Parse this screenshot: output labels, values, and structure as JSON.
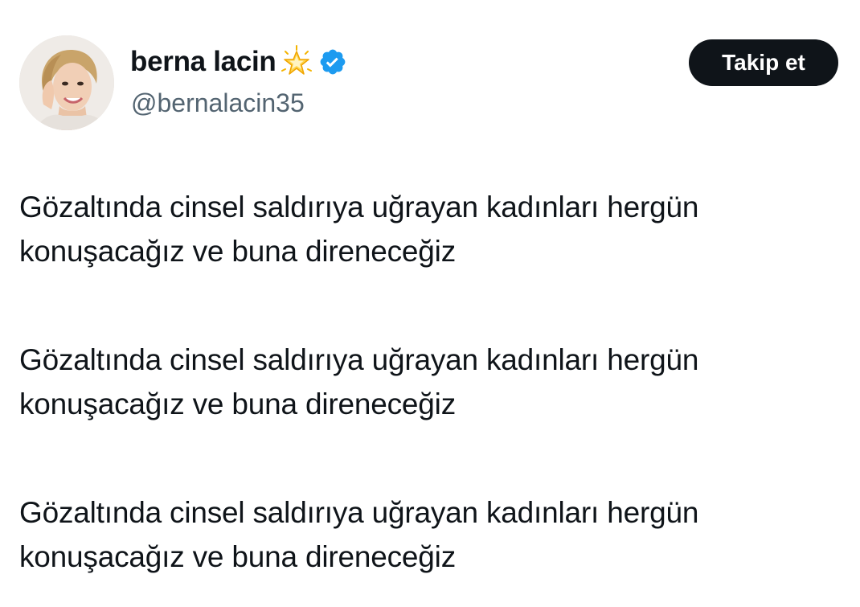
{
  "author": {
    "display_name": "berna lacin",
    "handle": "@bernalacin35",
    "badges": [
      "star-icon",
      "verified-icon"
    ],
    "verified_color": "#1d9bf0"
  },
  "actions": {
    "follow_label": "Takip et"
  },
  "tweet": {
    "paragraphs": [
      {
        "line1": "Gözaltında cinsel saldırıya uğrayan kadınları hergün",
        "line2": "konuşacağız ve buna direneceğiz"
      },
      {
        "line1": "Gözaltında cinsel saldırıya uğrayan kadınları hergün",
        "line2": "konuşacağız ve buna direneceğiz"
      },
      {
        "line1": "Gözaltında cinsel saldırıya uğrayan kadınları hergün",
        "line2": "konuşacağız ve buna direneceğiz"
      }
    ]
  }
}
